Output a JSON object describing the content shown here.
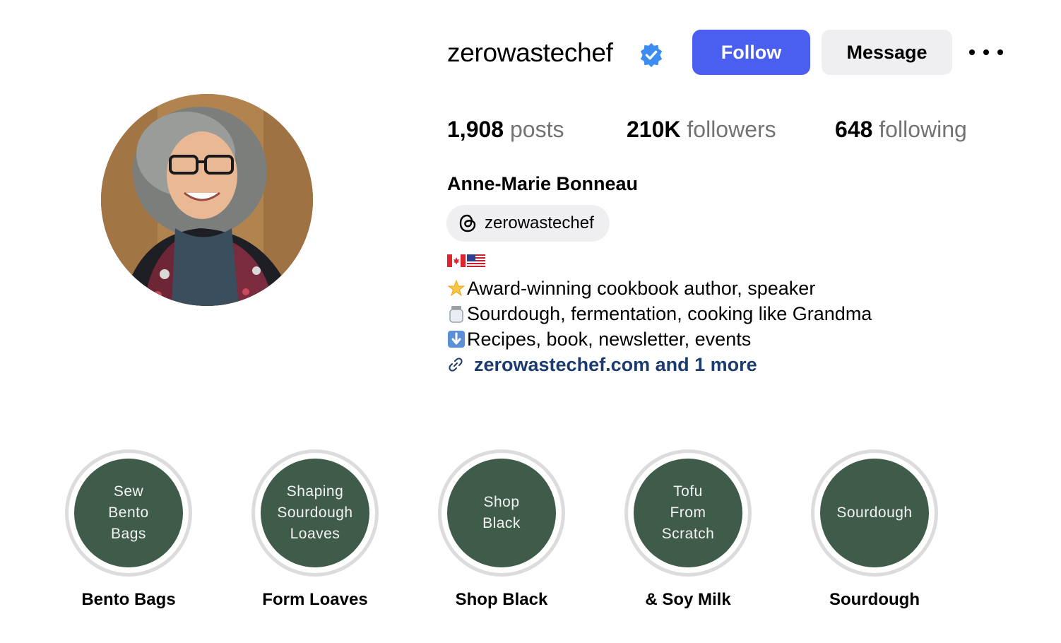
{
  "profile": {
    "username": "zerowastechef",
    "full_name": "Anne-Marie Bonneau",
    "threads_handle": "zerowastechef",
    "verified_icon": "verified-badge-icon",
    "brand_color": "#4a5ef0"
  },
  "actions": {
    "follow_label": "Follow",
    "message_label": "Message",
    "more_icon": "more-options-icon"
  },
  "stats": {
    "posts_count": "1,908",
    "posts_label": "posts",
    "followers_count": "210K",
    "followers_label": "followers",
    "following_count": "648",
    "following_label": "following"
  },
  "bio": {
    "flags": [
      "canada-flag-icon",
      "usa-flag-icon"
    ],
    "line1_icon": "star-icon",
    "line1": "Award-winning cookbook author, speaker",
    "line2_icon": "jar-icon",
    "line2": "Sourdough, fermentation, cooking like Grandma",
    "line3_icon": "down-arrow-icon",
    "line3": " Recipes, book, newsletter, events",
    "link_icon": "link-icon",
    "link_text": "zerowastechef.com and 1 more"
  },
  "highlights": [
    {
      "cover_text": "Sew\nBento\nBags",
      "title": "Bento Bags"
    },
    {
      "cover_text": "Shaping\nSourdough\nLoaves",
      "title": "Form Loaves"
    },
    {
      "cover_text": "Shop\nBlack",
      "title": "Shop Black"
    },
    {
      "cover_text": "Tofu\nFrom\nScratch",
      "title": "& Soy Milk"
    },
    {
      "cover_text": "Sourdough",
      "title": "Sourdough"
    }
  ],
  "colors": {
    "highlight_cover": "#3f5c4b",
    "link": "#1c3b6e",
    "muted_text": "#737373",
    "button_secondary": "#efeff2"
  }
}
